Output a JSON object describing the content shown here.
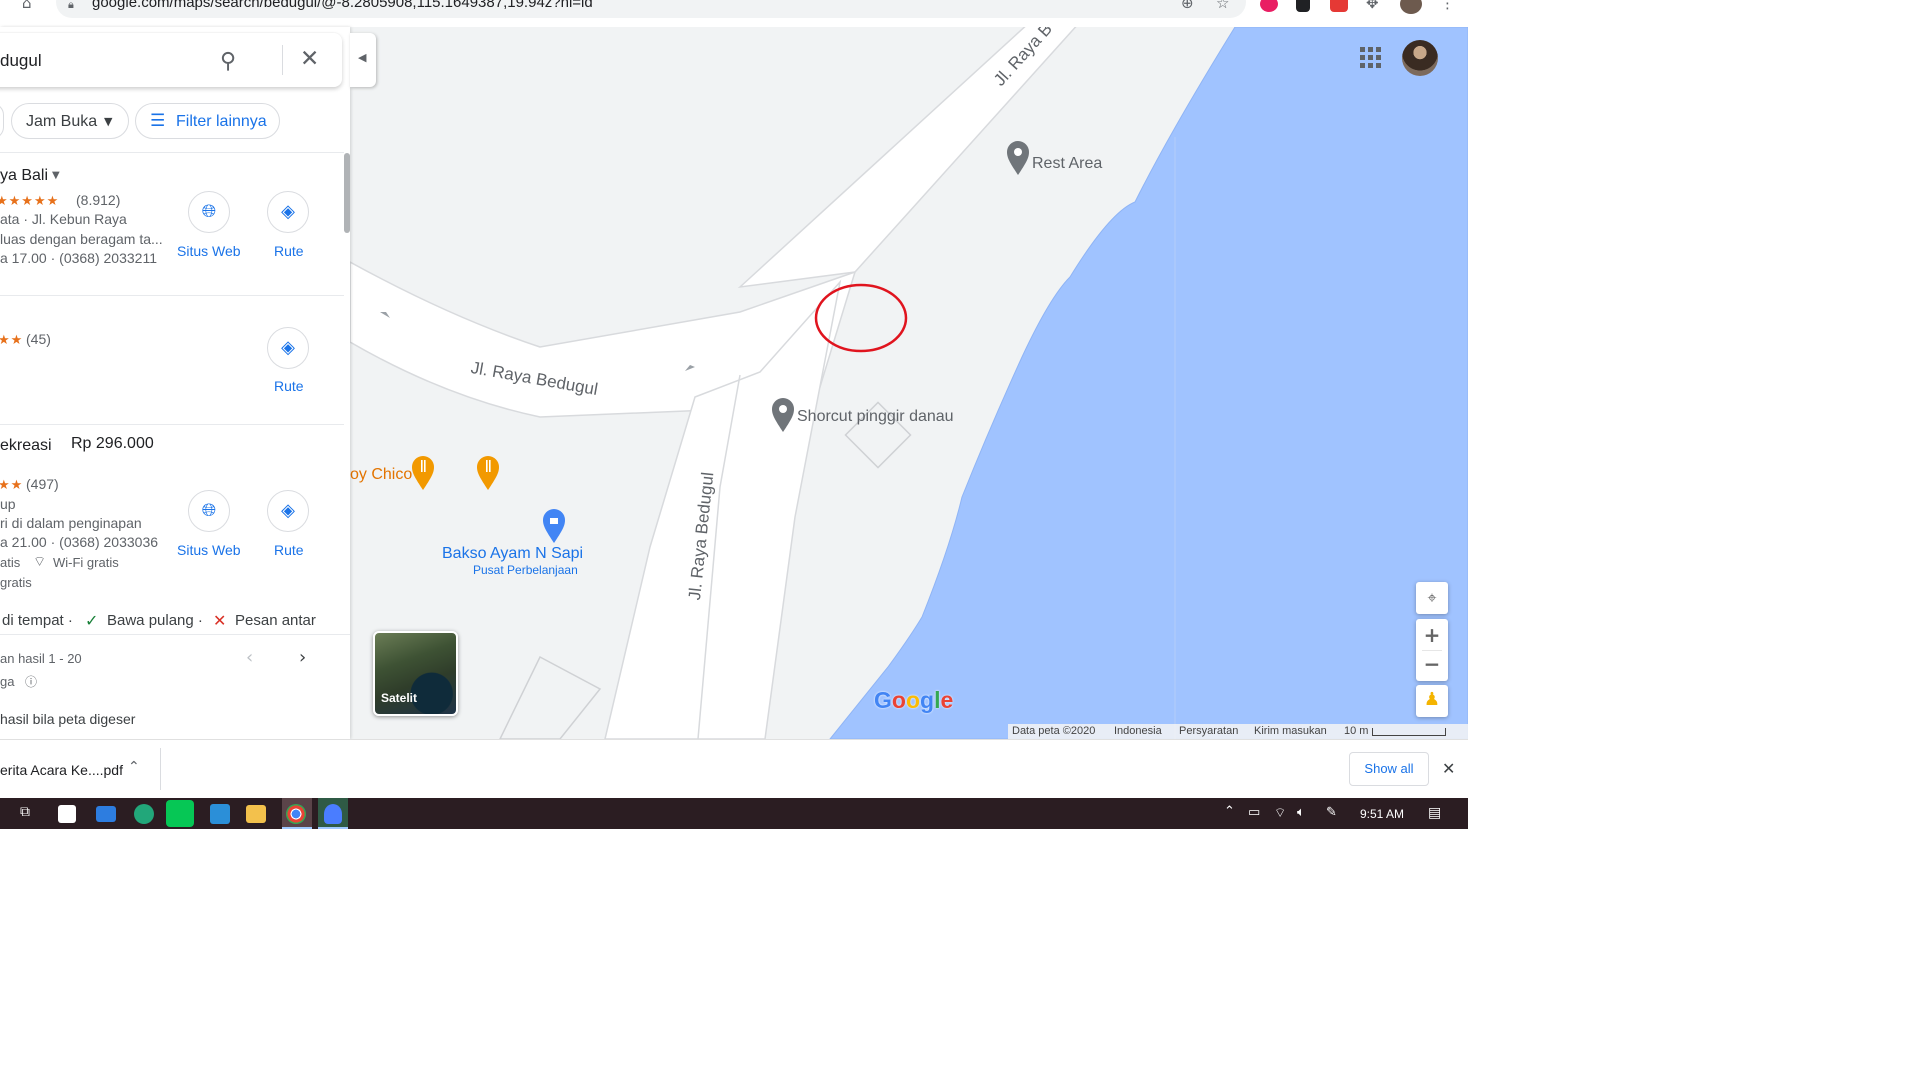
{
  "browser": {
    "url": "google.com/maps/search/bedugul/@-8.2805908,115.1649387,19.94z?hl=id",
    "icons": [
      "home-icon",
      "lock-icon",
      "add-icon",
      "star-icon",
      "extension-icons",
      "puzzle-icon",
      "profile-avatar",
      "menu-icon"
    ]
  },
  "search": {
    "query_fragment": "dugul"
  },
  "filters": {
    "jam_buka": "Jam Buka",
    "filter_lainnya": "Filter lainnya"
  },
  "results": [
    {
      "name_fragment": "ya Bali",
      "stars": "★★★★★",
      "reviews": "(8.912)",
      "line1": "ata · Jl. Kebun Raya",
      "line2": "luas dengan beragam ta...",
      "line3": "a 17.00 · (0368) 2033211",
      "website_label": "Situs Web",
      "route_label": "Rute"
    },
    {
      "stars": "★★",
      "reviews": "(45)",
      "route_label": "Rute"
    },
    {
      "name_fragment": "ekreasi",
      "price": "Rp 296.000",
      "stars": "★★",
      "reviews": "(497)",
      "line1": "up",
      "line2": "ri di dalam penginapan",
      "line3": "a 21.00 · (0368) 2033036",
      "line4a": "atis",
      "wifi": "Wi-Fi gratis",
      "line5": "gratis",
      "website_label": "Situs Web",
      "route_label": "Rute"
    }
  ],
  "services": {
    "dine_in": "di tempat ·",
    "takeaway": "Bawa pulang ·",
    "delivery": "Pesan antar"
  },
  "pagination": {
    "range": "an hasil 1 - 20",
    "price_note": "ga",
    "update_note": "hasil bila peta digeser"
  },
  "map": {
    "road_1": "Jl. Raya Bedugul",
    "road_2": "Jl. Raya Bedugul",
    "road_3": "Jl. Raya B",
    "poi_rest_area": "Rest Area",
    "poi_shortcut": "Shorcut pinggir danau",
    "poi_chico": "oy Chico",
    "poi_bakso": "Bakso Ayam N Sapi",
    "poi_bakso_type": "Pusat Perbelanjaan",
    "satellite_label": "Satelit",
    "logo": "Google",
    "attribution": {
      "data": "Data peta ©2020",
      "region": "Indonesia",
      "terms": "Persyaratan",
      "feedback": "Kirim masukan",
      "scale": "10 m"
    },
    "colors": {
      "water": "#a0c3ff",
      "land": "#f1f3f4",
      "road": "#ffffff",
      "annotation": "#e0141e"
    }
  },
  "download": {
    "file": "erita Acara Ke....pdf",
    "show_all": "Show all"
  },
  "taskbar": {
    "time": "9:51 AM"
  }
}
